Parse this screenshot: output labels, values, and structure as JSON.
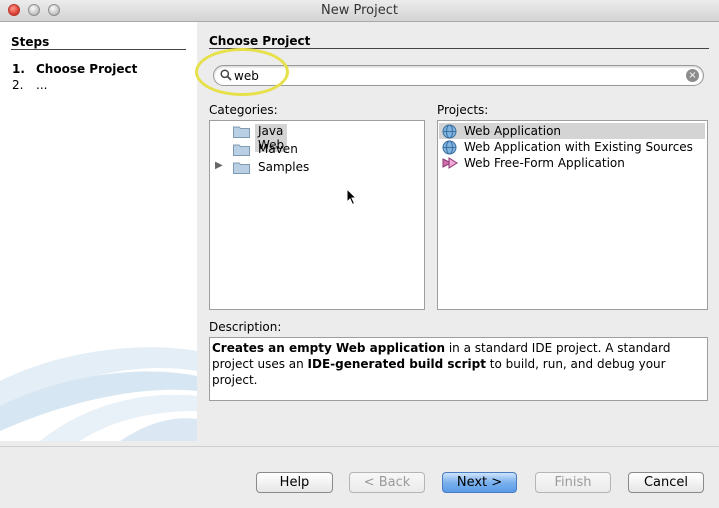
{
  "window": {
    "title": "New Project"
  },
  "steps": {
    "title": "Steps",
    "items": [
      {
        "num": "1.",
        "label": "Choose Project"
      },
      {
        "num": "2.",
        "label": "..."
      }
    ]
  },
  "main": {
    "title": "Choose Project",
    "search": {
      "value": "web",
      "icon": "search-icon",
      "clear_icon": "clear-icon",
      "clear_glyph": "×"
    },
    "categories": {
      "label": "Categories:",
      "items": [
        {
          "label": "Java Web",
          "selected": true,
          "expandable": false
        },
        {
          "label": "Maven",
          "selected": false,
          "expandable": false
        },
        {
          "label": "Samples",
          "selected": false,
          "expandable": true,
          "arrow": "▶"
        }
      ]
    },
    "projects": {
      "label": "Projects:",
      "items": [
        {
          "label": "Web Application",
          "selected": true,
          "icon": "globe-icon"
        },
        {
          "label": "Web Application with Existing Sources",
          "selected": false,
          "icon": "globe-icon"
        },
        {
          "label": "Web Free-Form Application",
          "selected": false,
          "icon": "freeform-icon"
        }
      ]
    },
    "description": {
      "label": "Description:",
      "parts": [
        {
          "text": "Creates an empty Web application",
          "bold": true
        },
        {
          "text": " in a standard IDE project. A standard project uses an ",
          "bold": false
        },
        {
          "text": "IDE-generated build script",
          "bold": true
        },
        {
          "text": " to build, run, and debug your project.",
          "bold": false
        }
      ]
    }
  },
  "buttons": {
    "help": "Help",
    "back": "< Back",
    "next": "Next >",
    "finish": "Finish",
    "cancel": "Cancel"
  },
  "colors": {
    "highlight_ring": "#e6e04a",
    "selection": "#d4d4d4",
    "primary_button": "#5a9be6"
  }
}
